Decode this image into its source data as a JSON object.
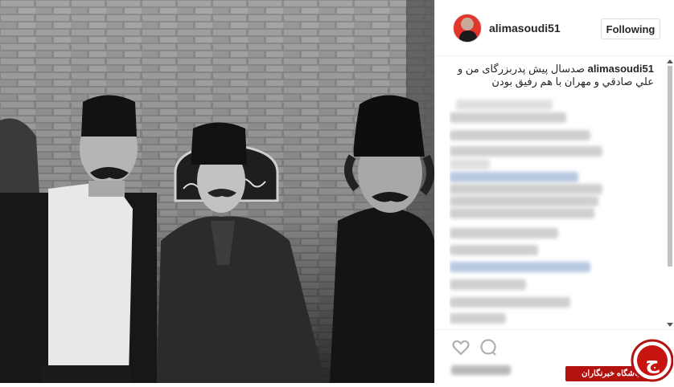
{
  "post": {
    "username": "alimasoudi51",
    "follow_label": "Following",
    "caption_user": "alimasoudi51",
    "caption_text": "صدسال پیش پدربزرگای من و علي صادقي و مهران با هم رفيق بودن"
  },
  "watermark": {
    "label": "باشگاه خبرنگاران",
    "logo_glyph": "ج"
  },
  "colors": {
    "watermark_red": "#b3120f",
    "avatar_red": "#e2352c"
  },
  "icons": [
    "heart-icon",
    "comment-icon"
  ]
}
